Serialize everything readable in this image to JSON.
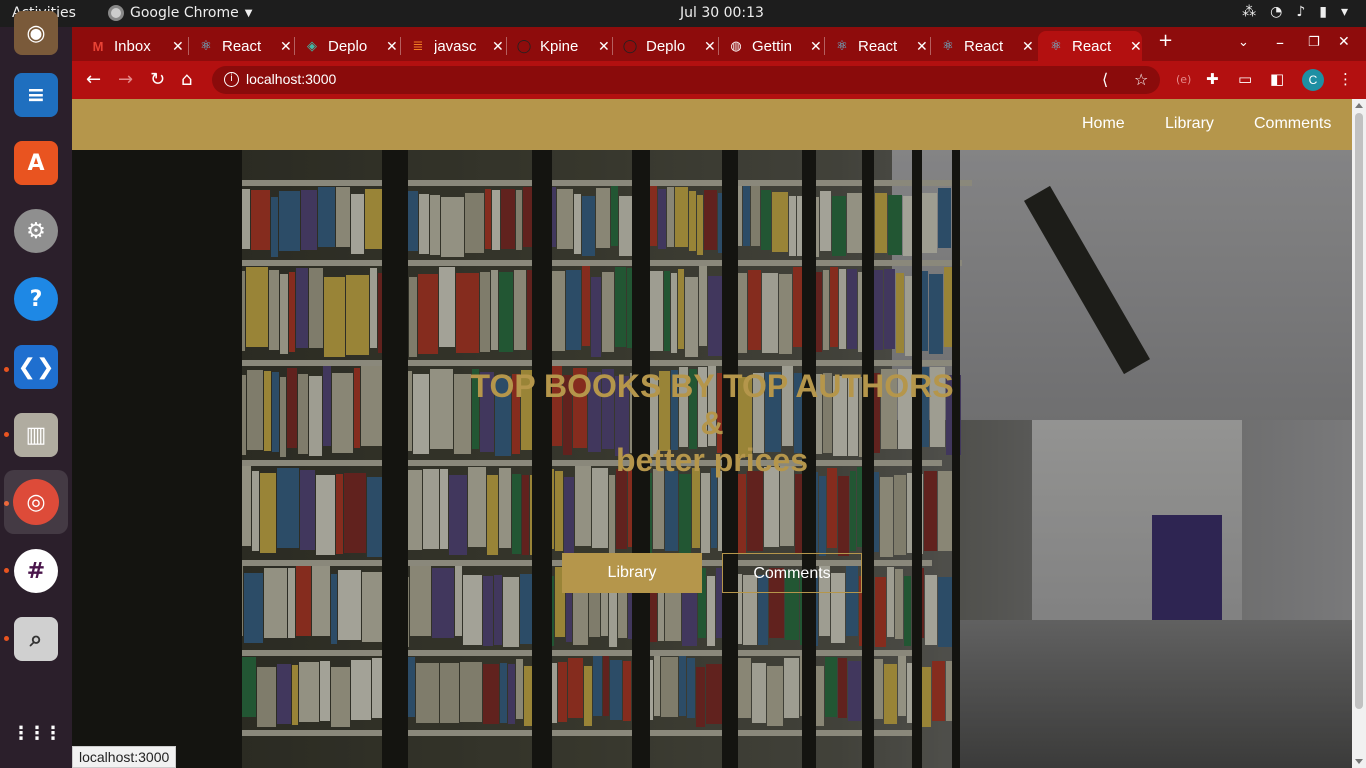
{
  "system": {
    "activities": "Activities",
    "app_name": "Google Chrome",
    "clock": "Jul 30  00:13"
  },
  "dock": {
    "items": [
      {
        "name": "rhythmbox",
        "color": "#7a5a3a"
      },
      {
        "name": "libreoffice-writer",
        "color": "#1f6fbf"
      },
      {
        "name": "ubuntu-software",
        "color": "#e95420"
      },
      {
        "name": "settings",
        "color": "#999999"
      },
      {
        "name": "help",
        "color": "#1e88e5"
      },
      {
        "name": "vscode",
        "color": "#1f6fcf"
      },
      {
        "name": "archive-manager",
        "color": "#b0aca0"
      },
      {
        "name": "chrome",
        "color": "#dd4b39"
      },
      {
        "name": "slack",
        "color": "#ffffff"
      },
      {
        "name": "image-viewer",
        "color": "#d0d0d0"
      }
    ],
    "apps_grid": "⋮⋮⋮"
  },
  "browser": {
    "tabs": [
      {
        "label": "Inbox",
        "icon": "gmail-icon"
      },
      {
        "label": "React",
        "icon": "react-icon"
      },
      {
        "label": "Deplo",
        "icon": "netlify-icon"
      },
      {
        "label": "javasc",
        "icon": "stackoverflow-icon"
      },
      {
        "label": "Kpine",
        "icon": "github-icon"
      },
      {
        "label": "Deplo",
        "icon": "github-icon"
      },
      {
        "label": "Gettin",
        "icon": "globe-icon"
      },
      {
        "label": "React",
        "icon": "react-icon"
      },
      {
        "label": "React",
        "icon": "react-icon"
      },
      {
        "label": "React",
        "icon": "react-icon"
      }
    ],
    "url": "localhost:3000",
    "profile_initial": "C",
    "status_url": "localhost:3000"
  },
  "site": {
    "nav": {
      "home": "Home",
      "library": "Library",
      "comments": "Comments"
    },
    "hero": {
      "line1": "TOP BOOKS BY TOP AUTHORS",
      "line2": "&",
      "line3": "better prices",
      "btn_library": "Library",
      "btn_comments": "Comments"
    },
    "accent_color": "#b5964b"
  }
}
